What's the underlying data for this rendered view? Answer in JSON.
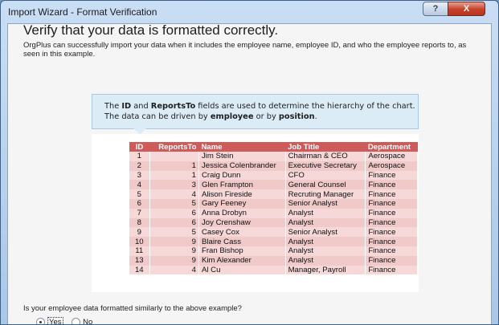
{
  "window": {
    "title": "Import Wizard - Format Verification",
    "help_label": "?",
    "close_label": "X"
  },
  "main": {
    "heading": "Verify that your data is formatted correctly.",
    "description": "OrgPlus can successfully import your data when it includes the employee name, employee ID, and who the employee reports to, as seen in this example."
  },
  "callout": {
    "line1": [
      "The ",
      "ID",
      " and ",
      "ReportsTo",
      " fields are used to determine the hierarchy of the chart."
    ],
    "line2": [
      "The data can be driven by ",
      "employee",
      " or by ",
      "position",
      "."
    ]
  },
  "example_table": {
    "columns": [
      "ID",
      "ReportsTo",
      "Name",
      "Job Title",
      "Department"
    ],
    "rows": [
      [
        "1",
        "",
        "Jim Stein",
        "Chairman & CEO",
        "Aerospace"
      ],
      [
        "2",
        "1",
        "Jessica Colenbrander",
        "Executive Secretary",
        "Aerospace"
      ],
      [
        "3",
        "1",
        "Craig Dunn",
        "CFO",
        "Finance"
      ],
      [
        "4",
        "3",
        "Glen Frampton",
        "General Counsel",
        "Finance"
      ],
      [
        "5",
        "4",
        "Alison Fireside",
        "Recruting Manager",
        "Finance"
      ],
      [
        "6",
        "5",
        "Gary Feeney",
        "Senior Analyst",
        "Finance"
      ],
      [
        "7",
        "6",
        "Anna Drobyn",
        "Analyst",
        "Finance"
      ],
      [
        "8",
        "6",
        "Joy Crenshaw",
        "Analyst",
        "Finance"
      ],
      [
        "9",
        "5",
        "Casey Cox",
        "Senior Analyst",
        "Finance"
      ],
      [
        "10",
        "9",
        "Blaire Cass",
        "Analyst",
        "Finance"
      ],
      [
        "11",
        "9",
        "Fran Bishop",
        "Analyst",
        "Finance"
      ],
      [
        "13",
        "9",
        "Kim Alexander",
        "Analyst",
        "Finance"
      ],
      [
        "14",
        "4",
        "Al Cu",
        "Manager, Payroll",
        "Finance"
      ]
    ]
  },
  "question": {
    "text": "Is your employee data formatted similarly to the above example?",
    "options": [
      {
        "label": "Yes",
        "selected": true
      },
      {
        "label": "No",
        "selected": false
      }
    ]
  },
  "colors": {
    "header_red": "#cf5a5a",
    "row_pink": "#f6d8d8",
    "callout_blue": "#dcecf7"
  }
}
